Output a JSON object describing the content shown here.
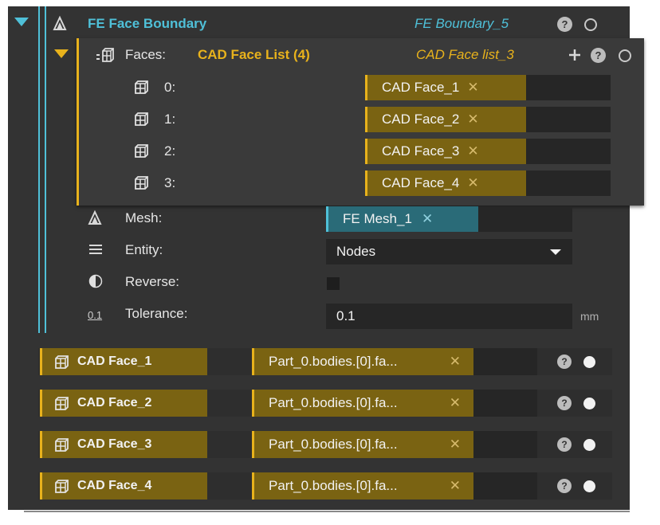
{
  "boundary": {
    "title": "FE Face Boundary",
    "instance_name": "FE Boundary_5",
    "help_icon": "question-icon",
    "status_icon": "ring-icon"
  },
  "faces": {
    "label": "Faces:",
    "value": "CAD Face List (4)",
    "instance_name": "CAD Face list_3",
    "add_icon": "plus-icon",
    "items": [
      {
        "index": "0:",
        "value": "CAD Face_1"
      },
      {
        "index": "1:",
        "value": "CAD Face_2"
      },
      {
        "index": "2:",
        "value": "CAD Face_3"
      },
      {
        "index": "3:",
        "value": "CAD Face_4"
      }
    ]
  },
  "mesh": {
    "label": "Mesh:",
    "value": "FE Mesh_1"
  },
  "entity": {
    "label": "Entity:",
    "value": "Nodes"
  },
  "reverse": {
    "label": "Reverse:"
  },
  "tolerance": {
    "label": "Tolerance:",
    "value": "0.1",
    "unit": "mm",
    "icon_text": "0.1"
  },
  "remove_glyph": "✕",
  "cad_faces": [
    {
      "name": "CAD Face_1",
      "ref": "Part_0.bodies.[0].fa..."
    },
    {
      "name": "CAD Face_2",
      "ref": "Part_0.bodies.[0].fa..."
    },
    {
      "name": "CAD Face_3",
      "ref": "Part_0.bodies.[0].fa..."
    },
    {
      "name": "CAD Face_4",
      "ref": "Part_0.bodies.[0].fa..."
    }
  ],
  "colors": {
    "accent_cyan": "#4fc0d8",
    "accent_gold": "#e8b21c",
    "gold_fill": "#7a6312",
    "cyan_fill": "#2a6b78",
    "panel_bg": "#333333"
  }
}
